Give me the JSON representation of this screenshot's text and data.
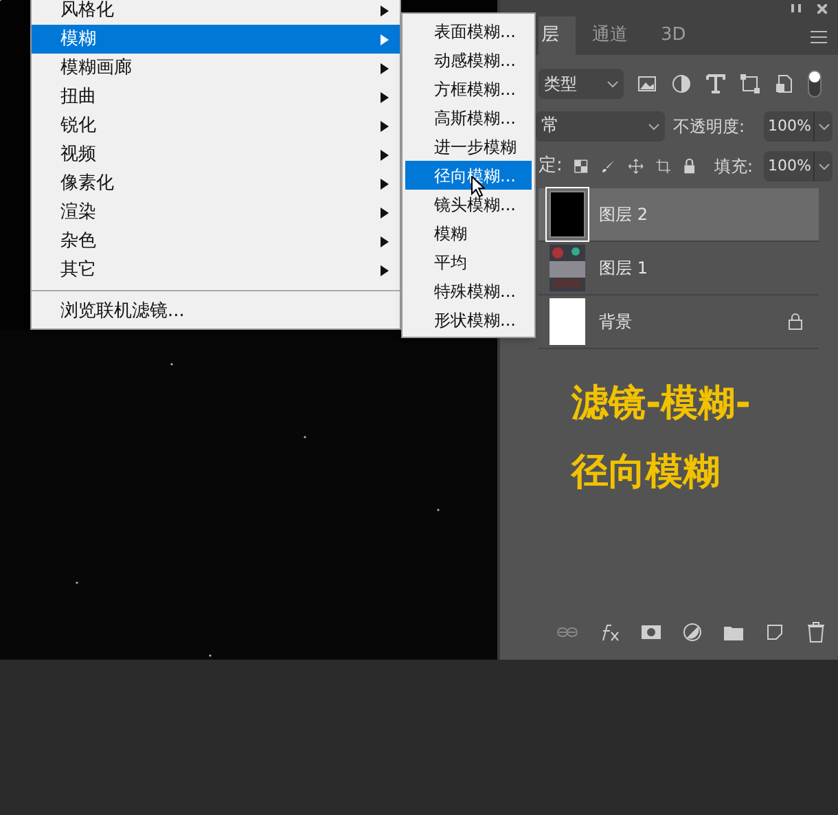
{
  "menu": {
    "items": [
      {
        "kind": "item",
        "label": "风格化",
        "selected": false,
        "submenu": true
      },
      {
        "kind": "item",
        "label": "模糊",
        "selected": true,
        "submenu": true
      },
      {
        "kind": "item",
        "label": "模糊画廊",
        "selected": false,
        "submenu": true
      },
      {
        "kind": "item",
        "label": "扭曲",
        "selected": false,
        "submenu": true
      },
      {
        "kind": "item",
        "label": "锐化",
        "selected": false,
        "submenu": true
      },
      {
        "kind": "item",
        "label": "视频",
        "selected": false,
        "submenu": true
      },
      {
        "kind": "item",
        "label": "像素化",
        "selected": false,
        "submenu": true
      },
      {
        "kind": "item",
        "label": "渲染",
        "selected": false,
        "submenu": true
      },
      {
        "kind": "item",
        "label": "杂色",
        "selected": false,
        "submenu": true
      },
      {
        "kind": "item",
        "label": "其它",
        "selected": false,
        "submenu": true
      },
      {
        "kind": "separator"
      },
      {
        "kind": "item",
        "label": "浏览联机滤镜...",
        "selected": false,
        "submenu": false
      }
    ]
  },
  "submenu": {
    "items": [
      {
        "label": "表面模糊...",
        "selected": false
      },
      {
        "label": "动感模糊...",
        "selected": false
      },
      {
        "label": "方框模糊...",
        "selected": false
      },
      {
        "label": "高斯模糊...",
        "selected": false
      },
      {
        "label": "进一步模糊",
        "selected": false
      },
      {
        "label": "径向模糊...",
        "selected": true
      },
      {
        "label": "镜头模糊...",
        "selected": false
      },
      {
        "label": "模糊",
        "selected": false
      },
      {
        "label": "平均",
        "selected": false
      },
      {
        "label": "特殊模糊...",
        "selected": false
      },
      {
        "label": "形状模糊...",
        "selected": false
      }
    ]
  },
  "panel": {
    "tabs": [
      {
        "label": "层",
        "selected": true
      },
      {
        "label": "通道",
        "selected": false
      },
      {
        "label": "3D",
        "selected": false
      }
    ],
    "filter": {
      "value": "类型"
    },
    "blend": {
      "value": "常"
    },
    "opacity": {
      "label": "不透明度:",
      "value": "100%"
    },
    "lock": {
      "label": "定:"
    },
    "fill": {
      "label": "填充:",
      "value": "100%"
    },
    "layers": [
      {
        "name": "图层 2",
        "selected": true,
        "kind": "dark",
        "locked": false
      },
      {
        "name": "图层 1",
        "selected": false,
        "locked": false
      },
      {
        "name": "背景",
        "selected": false,
        "kind": "white",
        "locked": true
      }
    ],
    "annotation": [
      "滤镜-模糊-",
      "径向模糊"
    ]
  }
}
